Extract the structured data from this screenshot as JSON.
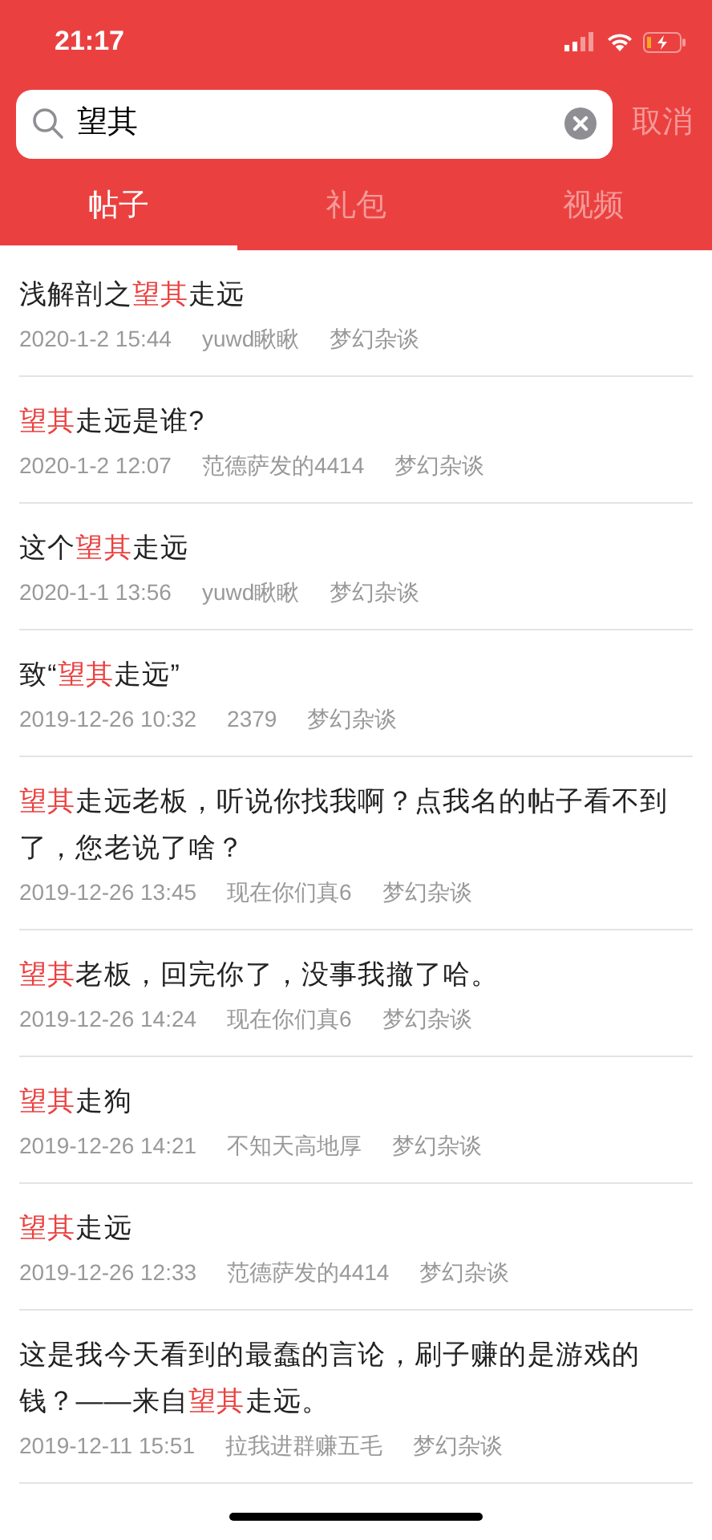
{
  "status_bar": {
    "time": "21:17"
  },
  "search": {
    "value": "望其",
    "cancel": "取消"
  },
  "tabs": [
    {
      "label": "帖子",
      "selected": true
    },
    {
      "label": "礼包",
      "selected": false
    },
    {
      "label": "视频",
      "selected": false
    }
  ],
  "posts": [
    {
      "title": [
        {
          "text": "浅解剖之",
          "highlight": false
        },
        {
          "text": "望其",
          "highlight": true
        },
        {
          "text": "走远",
          "highlight": false
        }
      ],
      "date": "2020-1-2 15:44",
      "author": "yuwd瞅瞅",
      "forum": "梦幻杂谈"
    },
    {
      "title": [
        {
          "text": "望其",
          "highlight": true
        },
        {
          "text": "走远是谁?",
          "highlight": false
        }
      ],
      "date": "2020-1-2 12:07",
      "author": "范德萨发的4414",
      "forum": "梦幻杂谈"
    },
    {
      "title": [
        {
          "text": "这个",
          "highlight": false
        },
        {
          "text": "望其",
          "highlight": true
        },
        {
          "text": "走远",
          "highlight": false
        }
      ],
      "date": "2020-1-1 13:56",
      "author": "yuwd瞅瞅",
      "forum": "梦幻杂谈"
    },
    {
      "title": [
        {
          "text": "致“",
          "highlight": false
        },
        {
          "text": "望其",
          "highlight": true
        },
        {
          "text": "走远”",
          "highlight": false
        }
      ],
      "date": "2019-12-26 10:32",
      "author": "2379",
      "forum": "梦幻杂谈"
    },
    {
      "title": [
        {
          "text": "望其",
          "highlight": true
        },
        {
          "text": "走远老板，听说你找我啊？点我名的帖子看不到了，您老说了啥？",
          "highlight": false
        }
      ],
      "date": "2019-12-26 13:45",
      "author": "现在你们真6",
      "forum": "梦幻杂谈"
    },
    {
      "title": [
        {
          "text": "望其",
          "highlight": true
        },
        {
          "text": "老板，回完你了，没事我撤了哈。",
          "highlight": false
        }
      ],
      "date": "2019-12-26 14:24",
      "author": "现在你们真6",
      "forum": "梦幻杂谈"
    },
    {
      "title": [
        {
          "text": "望其",
          "highlight": true
        },
        {
          "text": "走狗",
          "highlight": false
        }
      ],
      "date": "2019-12-26 14:21",
      "author": "不知天高地厚",
      "forum": "梦幻杂谈"
    },
    {
      "title": [
        {
          "text": "望其",
          "highlight": true
        },
        {
          "text": "走远",
          "highlight": false
        }
      ],
      "date": "2019-12-26 12:33",
      "author": "范德萨发的4414",
      "forum": "梦幻杂谈"
    },
    {
      "title": [
        {
          "text": "这是我今天看到的最蠢的言论，刷子赚的是游戏的钱？——来自",
          "highlight": false
        },
        {
          "text": "望其",
          "highlight": true
        },
        {
          "text": "走远。",
          "highlight": false
        }
      ],
      "date": "2019-12-11 15:51",
      "author": "拉我进群赚五毛",
      "forum": "梦幻杂谈"
    }
  ]
}
